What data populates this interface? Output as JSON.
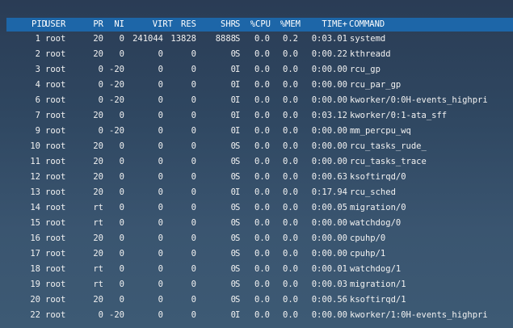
{
  "columns": [
    "PID",
    "USER",
    "PR",
    "NI",
    "VIRT",
    "RES",
    "SHR",
    "S",
    "%CPU",
    "%MEM",
    "TIME+",
    "COMMAND"
  ],
  "rows": [
    [
      "1",
      "root",
      "20",
      "0",
      "241044",
      "13828",
      "8888",
      "S",
      "0.0",
      "0.2",
      "0:03.01",
      "systemd"
    ],
    [
      "2",
      "root",
      "20",
      "0",
      "0",
      "0",
      "0",
      "S",
      "0.0",
      "0.0",
      "0:00.22",
      "kthreadd"
    ],
    [
      "3",
      "root",
      "0",
      "-20",
      "0",
      "0",
      "0",
      "I",
      "0.0",
      "0.0",
      "0:00.00",
      "rcu_gp"
    ],
    [
      "4",
      "root",
      "0",
      "-20",
      "0",
      "0",
      "0",
      "I",
      "0.0",
      "0.0",
      "0:00.00",
      "rcu_par_gp"
    ],
    [
      "6",
      "root",
      "0",
      "-20",
      "0",
      "0",
      "0",
      "I",
      "0.0",
      "0.0",
      "0:00.00",
      "kworker/0:0H-events_highpri"
    ],
    [
      "7",
      "root",
      "20",
      "0",
      "0",
      "0",
      "0",
      "I",
      "0.0",
      "0.0",
      "0:03.12",
      "kworker/0:1-ata_sff"
    ],
    [
      "9",
      "root",
      "0",
      "-20",
      "0",
      "0",
      "0",
      "I",
      "0.0",
      "0.0",
      "0:00.00",
      "mm_percpu_wq"
    ],
    [
      "10",
      "root",
      "20",
      "0",
      "0",
      "0",
      "0",
      "S",
      "0.0",
      "0.0",
      "0:00.00",
      "rcu_tasks_rude_"
    ],
    [
      "11",
      "root",
      "20",
      "0",
      "0",
      "0",
      "0",
      "S",
      "0.0",
      "0.0",
      "0:00.00",
      "rcu_tasks_trace"
    ],
    [
      "12",
      "root",
      "20",
      "0",
      "0",
      "0",
      "0",
      "S",
      "0.0",
      "0.0",
      "0:00.63",
      "ksoftirqd/0"
    ],
    [
      "13",
      "root",
      "20",
      "0",
      "0",
      "0",
      "0",
      "I",
      "0.0",
      "0.0",
      "0:17.94",
      "rcu_sched"
    ],
    [
      "14",
      "root",
      "rt",
      "0",
      "0",
      "0",
      "0",
      "S",
      "0.0",
      "0.0",
      "0:00.05",
      "migration/0"
    ],
    [
      "15",
      "root",
      "rt",
      "0",
      "0",
      "0",
      "0",
      "S",
      "0.0",
      "0.0",
      "0:00.00",
      "watchdog/0"
    ],
    [
      "16",
      "root",
      "20",
      "0",
      "0",
      "0",
      "0",
      "S",
      "0.0",
      "0.0",
      "0:00.00",
      "cpuhp/0"
    ],
    [
      "17",
      "root",
      "20",
      "0",
      "0",
      "0",
      "0",
      "S",
      "0.0",
      "0.0",
      "0:00.00",
      "cpuhp/1"
    ],
    [
      "18",
      "root",
      "rt",
      "0",
      "0",
      "0",
      "0",
      "S",
      "0.0",
      "0.0",
      "0:00.01",
      "watchdog/1"
    ],
    [
      "19",
      "root",
      "rt",
      "0",
      "0",
      "0",
      "0",
      "S",
      "0.0",
      "0.0",
      "0:00.03",
      "migration/1"
    ],
    [
      "20",
      "root",
      "20",
      "0",
      "0",
      "0",
      "0",
      "S",
      "0.0",
      "0.0",
      "0:00.56",
      "ksoftirqd/1"
    ],
    [
      "22",
      "root",
      "0",
      "-20",
      "0",
      "0",
      "0",
      "I",
      "0.0",
      "0.0",
      "0:00.00",
      "kworker/1:0H-events_highpri"
    ]
  ]
}
